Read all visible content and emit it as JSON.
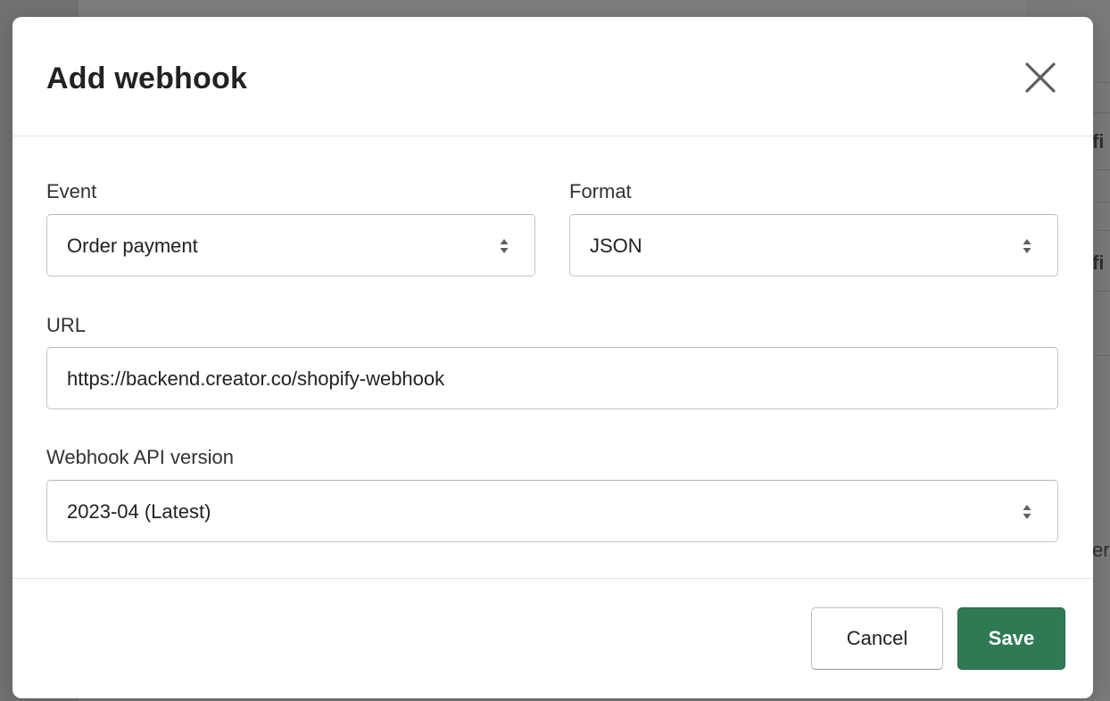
{
  "background": {
    "fragments": [
      "fi",
      "fi",
      "er"
    ]
  },
  "modal": {
    "title": "Add webhook",
    "close_icon": "close-x-icon",
    "event": {
      "label": "Event",
      "value": "Order payment"
    },
    "format": {
      "label": "Format",
      "value": "JSON"
    },
    "url": {
      "label": "URL",
      "value": "https://backend.creator.co/shopify-webhook"
    },
    "api_version": {
      "label": "Webhook API version",
      "value": "2023-04 (Latest)"
    },
    "footer": {
      "cancel_label": "Cancel",
      "save_label": "Save"
    }
  },
  "colors": {
    "primary": "#2f7a55",
    "overlay": "#7d7d7d",
    "text": "#202223",
    "border": "#c4c6c8"
  }
}
